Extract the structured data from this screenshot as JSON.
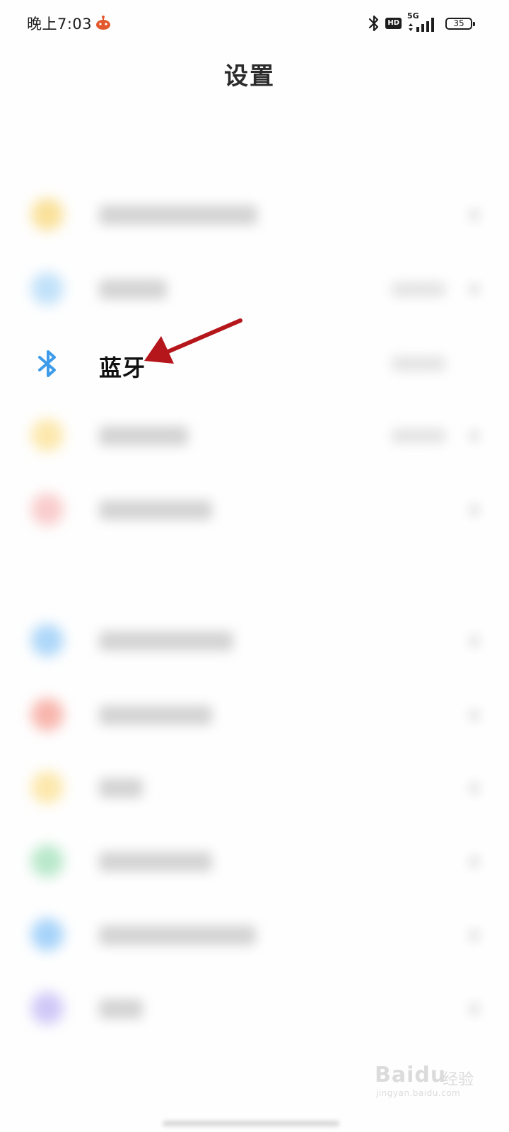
{
  "status_bar": {
    "time": "晚上7:03",
    "hd_label": "HD",
    "network_label": "5G",
    "battery_level": "35",
    "icons": [
      "app-notification-icon",
      "bluetooth-icon",
      "hd-icon",
      "signal-icon",
      "battery-icon"
    ]
  },
  "header": {
    "title": "设置"
  },
  "settings": {
    "bluetooth_label": "蓝牙",
    "bluetooth_icon": "bluetooth-icon",
    "accent_color": "#3d9be9"
  },
  "annotation": {
    "arrow_color": "#b5161b"
  },
  "watermark": {
    "brand": "Baidu",
    "product": "经验",
    "url": "jingyan.baidu.com"
  }
}
